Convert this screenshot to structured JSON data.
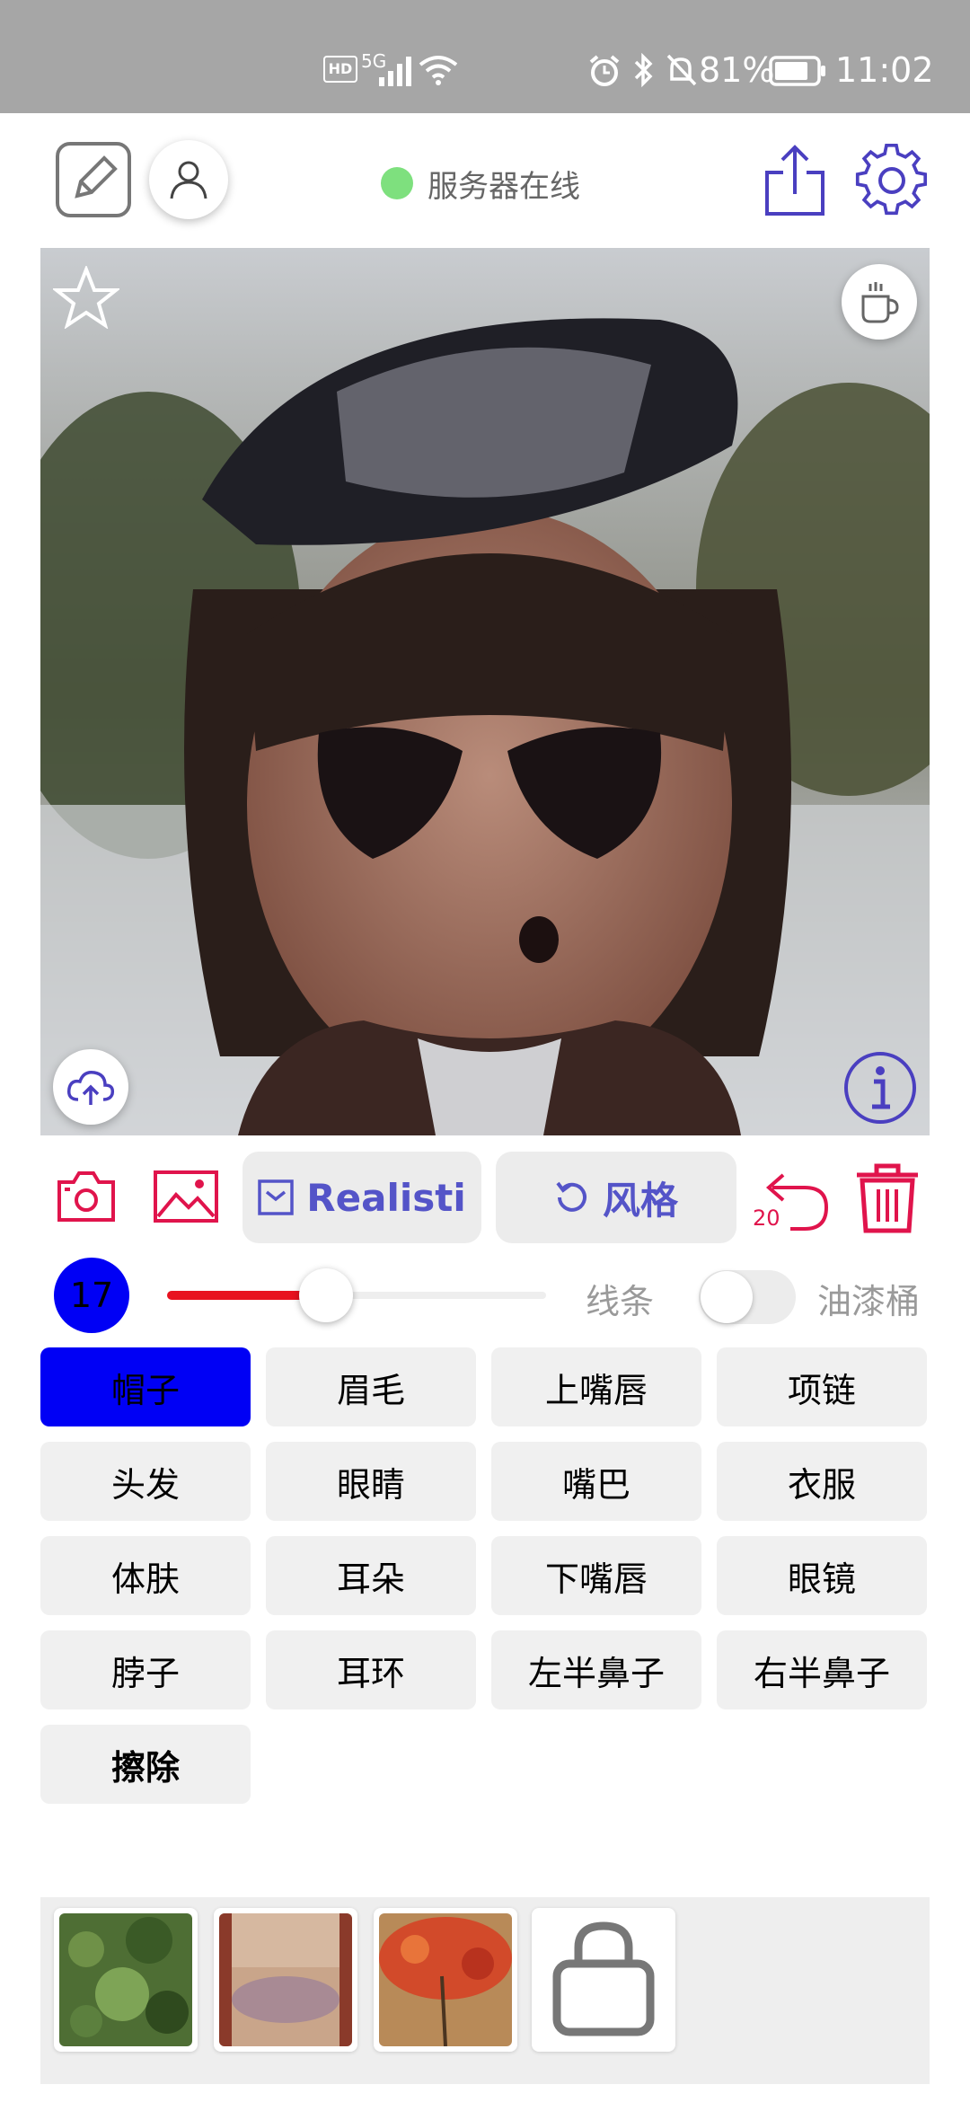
{
  "status_bar": {
    "network": "5G",
    "hd": "HD",
    "battery": "81%",
    "time": "11:02"
  },
  "header": {
    "server_status": "服务器在线",
    "status_color": "#7ee07e"
  },
  "icons": {
    "edit": "edit-icon",
    "user": "user-icon",
    "share": "share-icon",
    "settings": "gear-icon",
    "star": "star-icon",
    "coffee": "coffee-cup-icon",
    "upload": "cloud-upload-icon",
    "info": "info-icon",
    "camera": "camera-icon",
    "gallery": "image-icon",
    "undo": "undo-icon",
    "trash": "trash-icon",
    "bag": "shopping-bag-icon"
  },
  "tools": {
    "mode_label": "Realisti",
    "style_label": "风格",
    "undo_count": "20"
  },
  "brush": {
    "size": "17",
    "slider_level": 0.42,
    "line_label": "线条",
    "bucket_label": "油漆桶",
    "bucket_on": false
  },
  "parts": [
    {
      "label": "帽子",
      "selected": true
    },
    {
      "label": "眉毛",
      "selected": false
    },
    {
      "label": "上嘴唇",
      "selected": false
    },
    {
      "label": "项链",
      "selected": false
    },
    {
      "label": "头发",
      "selected": false
    },
    {
      "label": "眼睛",
      "selected": false
    },
    {
      "label": "嘴巴",
      "selected": false
    },
    {
      "label": "衣服",
      "selected": false
    },
    {
      "label": "体肤",
      "selected": false
    },
    {
      "label": "耳朵",
      "selected": false
    },
    {
      "label": "下嘴唇",
      "selected": false
    },
    {
      "label": "眼镜",
      "selected": false
    },
    {
      "label": "脖子",
      "selected": false
    },
    {
      "label": "耳环",
      "selected": false
    },
    {
      "label": "左半鼻子",
      "selected": false
    },
    {
      "label": "右半鼻子",
      "selected": false
    },
    {
      "label": "擦除",
      "selected": false
    }
  ],
  "colors": {
    "accent_red": "#e0144c",
    "accent_purple": "#4a3fc0",
    "brush_blue": "#0000f5",
    "slider_red": "#e8121f"
  }
}
